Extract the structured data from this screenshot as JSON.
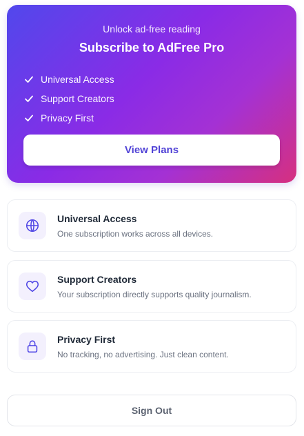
{
  "hero": {
    "eyebrow": "Unlock ad-free reading",
    "title": "Subscribe to AdFree Pro",
    "features": [
      {
        "label": "Universal Access",
        "icon": "check-icon"
      },
      {
        "label": "Support Creators",
        "icon": "check-icon"
      },
      {
        "label": "Privacy First",
        "icon": "check-icon"
      }
    ],
    "cta_label": "View Plans"
  },
  "cards": [
    {
      "icon": "globe-icon",
      "title": "Universal Access",
      "description": "One subscription works across all devices."
    },
    {
      "icon": "heart-icon",
      "title": "Support Creators",
      "description": "Your subscription directly supports quality journalism."
    },
    {
      "icon": "lock-icon",
      "title": "Privacy First",
      "description": "No tracking, no advertising. Just clean content."
    }
  ],
  "signout_label": "Sign Out",
  "colors": {
    "gradient_start": "#5148ec",
    "gradient_end": "#d6307f",
    "accent": "#5042d6",
    "icon_bg": "#f3f0fd"
  }
}
